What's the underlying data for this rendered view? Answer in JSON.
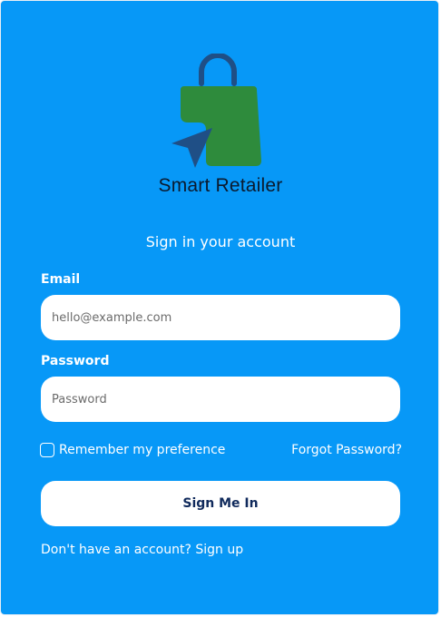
{
  "brand": {
    "name": "Smart Retailer",
    "logo_icon": "shopping-bag-cursor-icon"
  },
  "colors": {
    "background": "#0798F7",
    "bag_green": "#2E8B3C",
    "bag_handle": "#1F4F86",
    "cursor": "#1F4F86",
    "button_text": "#102A5C"
  },
  "form": {
    "heading": "Sign in your account",
    "email_label": "Email",
    "email_placeholder": "hello@example.com",
    "password_label": "Password",
    "password_placeholder": "Password",
    "remember_label": "Remember my preference",
    "forgot_label": "Forgot Password?",
    "submit_label": "Sign Me In",
    "signup_prompt": "Don't have an account?",
    "signup_link": "Sign up"
  }
}
